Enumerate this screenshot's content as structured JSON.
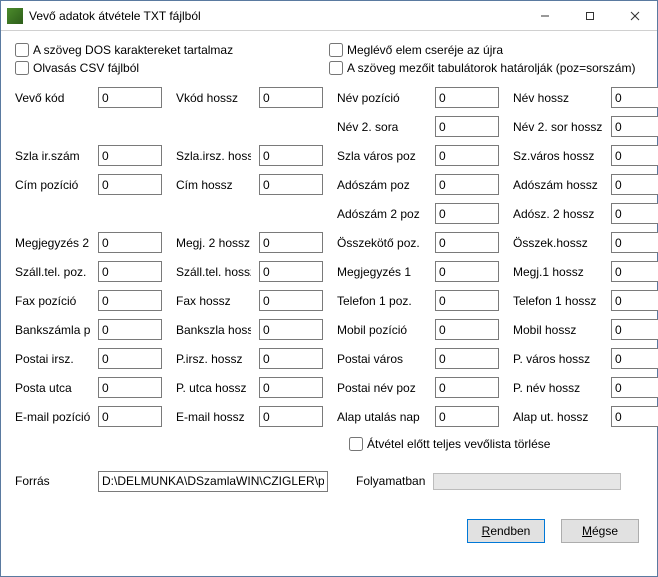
{
  "window": {
    "title": "Vevő adatok átvétele TXT fájlból"
  },
  "checks": {
    "dos": "A szöveg DOS karaktereket tartalmaz",
    "csv": "Olvasás CSV fájlból",
    "replace": "Meglévő elem cseréje az újra",
    "tabs": "A szöveg mezőit tabulátorok határolják (poz=sorszám)",
    "clear": "Átvétel előtt teljes vevőlista törlése"
  },
  "fields": {
    "vevo_kod": {
      "label": "Vevő kód",
      "value": "0"
    },
    "vkod_hossz": {
      "label": "Vkód hossz",
      "value": "0"
    },
    "nev_poz": {
      "label": "Név pozíció",
      "value": "0"
    },
    "nev_hossz": {
      "label": "Név hossz",
      "value": "0"
    },
    "nev2_sora": {
      "label": "Név 2. sora",
      "value": "0"
    },
    "nev2_sor_hossz": {
      "label": "Név 2. sor hossz",
      "value": "0"
    },
    "szla_irszam": {
      "label": "Szla ir.szám",
      "value": "0"
    },
    "szla_irsz_hossz": {
      "label": "Szla.irsz. hossz",
      "value": "0"
    },
    "szla_varos_poz": {
      "label": "Szla város poz",
      "value": "0"
    },
    "sz_varos_hossz": {
      "label": "Sz.város hossz",
      "value": "0"
    },
    "cim_poz": {
      "label": "Cím pozíció",
      "value": "0"
    },
    "cim_hossz": {
      "label": "Cím hossz",
      "value": "0"
    },
    "adoszam_poz": {
      "label": "Adószám poz",
      "value": "0"
    },
    "adoszam_hossz": {
      "label": "Adószám hossz",
      "value": "0"
    },
    "adoszam2_poz": {
      "label": "Adószám 2 poz",
      "value": "0"
    },
    "adosz2_hossz": {
      "label": "Adósz. 2 hossz",
      "value": "0"
    },
    "megj2": {
      "label": "Megjegyzés 2",
      "value": "0"
    },
    "megj2_hossz": {
      "label": "Megj. 2 hossz",
      "value": "0"
    },
    "osszekoto_poz": {
      "label": "Összekötő poz.",
      "value": "0"
    },
    "osszek_hossz": {
      "label": "Összek.hossz",
      "value": "0"
    },
    "szalltel_poz": {
      "label": "Száll.tel. poz.",
      "value": "0"
    },
    "szalltel_hossz": {
      "label": "Száll.tel. hossz",
      "value": "0"
    },
    "megj1": {
      "label": "Megjegyzés 1",
      "value": "0"
    },
    "megj1_hossz": {
      "label": "Megj.1 hossz",
      "value": "0"
    },
    "fax_poz": {
      "label": "Fax pozíció",
      "value": "0"
    },
    "fax_hossz": {
      "label": "Fax hossz",
      "value": "0"
    },
    "tel1_poz": {
      "label": "Telefon 1 poz.",
      "value": "0"
    },
    "tel1_hossz": {
      "label": "Telefon 1 hossz",
      "value": "0"
    },
    "bankszamla_poz": {
      "label": "Bankszámla poz.",
      "value": "0"
    },
    "bankszla_hossz": {
      "label": "Bankszla hossz",
      "value": "0"
    },
    "mobil_poz": {
      "label": "Mobil pozíció",
      "value": "0"
    },
    "mobil_hossz": {
      "label": "Mobil hossz",
      "value": "0"
    },
    "postai_irsz": {
      "label": "Postai irsz.",
      "value": "0"
    },
    "pirsz_hossz": {
      "label": "P.irsz. hossz",
      "value": "0"
    },
    "postai_varos": {
      "label": "Postai város",
      "value": "0"
    },
    "pvaros_hossz": {
      "label": "P. város hossz",
      "value": "0"
    },
    "posta_utca": {
      "label": "Posta utca",
      "value": "0"
    },
    "putca_hossz": {
      "label": "P. utca hossz",
      "value": "0"
    },
    "postai_nev_poz": {
      "label": "Postai név poz",
      "value": "0"
    },
    "pnev_hossz": {
      "label": "P. név hossz",
      "value": "0"
    },
    "email_poz": {
      "label": "E-mail pozíció",
      "value": "0"
    },
    "email_hossz": {
      "label": "E-mail hossz",
      "value": "0"
    },
    "alap_utalas_nap": {
      "label": "Alap utalás nap",
      "value": "0"
    },
    "alap_ut_hossz": {
      "label": "Alap ut. hossz",
      "value": "0"
    }
  },
  "forras": {
    "label": "Forrás",
    "value": "D:\\DELMUNKA\\DSzamlaWIN\\CZIGLER\\partnerek",
    "progress_label": "Folyamatban"
  },
  "buttons": {
    "ok": "Rendben",
    "cancel": "Mégse"
  }
}
